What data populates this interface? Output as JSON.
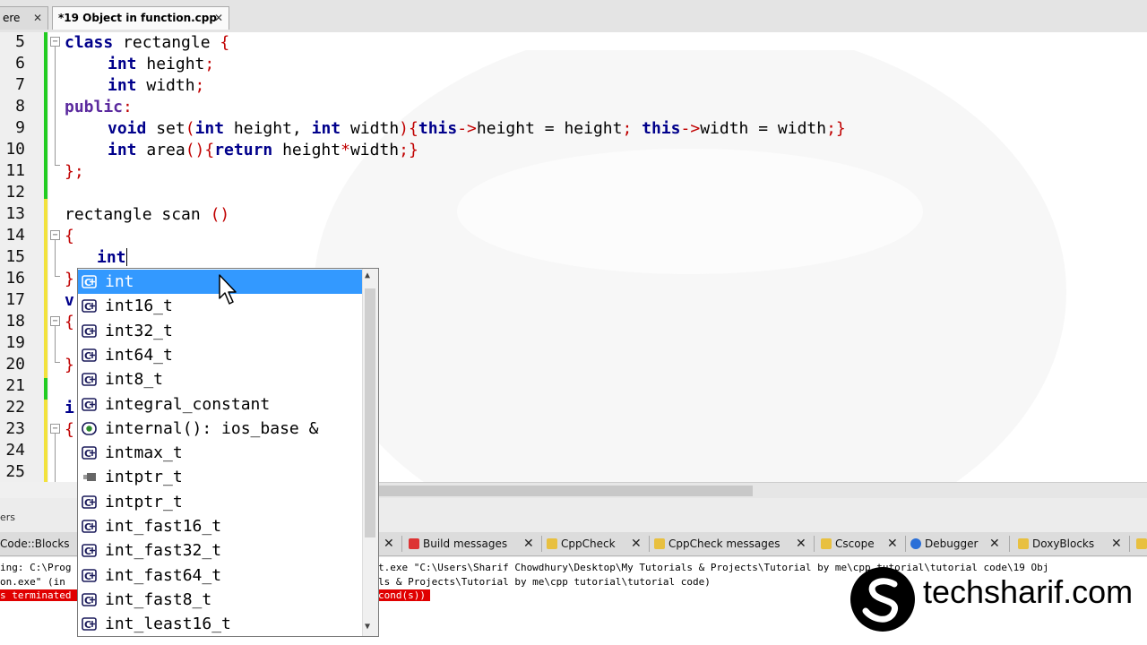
{
  "tabs": [
    {
      "label": "ere",
      "close": "✕"
    },
    {
      "label": "*19 Object in function.cpp",
      "close": "✕"
    }
  ],
  "editor": {
    "line_numbers": [
      "5",
      "6",
      "7",
      "8",
      "9",
      "10",
      "11",
      "12",
      "13",
      "14",
      "15",
      "16",
      "17",
      "18",
      "19",
      "20",
      "21",
      "22",
      "23",
      "24",
      "25"
    ],
    "lines": {
      "l5": {
        "kw": "class",
        "rest": " rectangle ",
        "brace": "{"
      },
      "l6": {
        "kw": "int",
        "rest": " height",
        "semi": ";"
      },
      "l7": {
        "kw": "int",
        "rest": " width",
        "semi": ";"
      },
      "l8": {
        "kw": "public",
        "rest": ":"
      },
      "l9": {
        "kw1": "void",
        "fn": " set",
        "p1": "(",
        "kw2": "int",
        "a": " height, ",
        "kw3": "int",
        "b": " width",
        "p2": "){",
        "kw4": "this",
        "arrow1": "->",
        "c": "height = height",
        "s1": ";",
        "sp": " ",
        "kw5": "this",
        "arrow2": "->",
        "d": "width = width",
        "s2": ";}"
      },
      "l10": {
        "kw1": "int",
        "fn": " area",
        "p": "(){",
        "kw2": "return",
        "rest": " height",
        "star": "*",
        "rest2": "width",
        "end": ";}"
      },
      "l11": {
        "rest": "};"
      },
      "l13": {
        "rest": "rectangle scan ",
        "paren": "()"
      },
      "l14": {
        "rest": "{"
      },
      "l15": {
        "rest": "int"
      },
      "l16": {
        "rest": "}"
      },
      "l17": {
        "rest": "v"
      },
      "l18": {
        "rest": "{"
      },
      "l20": {
        "rest": "}"
      },
      "l22": {
        "rest": "i"
      },
      "l23": {
        "rest": "{"
      }
    }
  },
  "autocomplete": {
    "items": [
      {
        "label": "int",
        "icon": "class-icon",
        "selected": true
      },
      {
        "label": "int16_t",
        "icon": "class-icon"
      },
      {
        "label": "int32_t",
        "icon": "class-icon"
      },
      {
        "label": "int64_t",
        "icon": "class-icon"
      },
      {
        "label": "int8_t",
        "icon": "class-icon"
      },
      {
        "label": "integral_constant",
        "icon": "class-icon"
      },
      {
        "label": "internal(): ios_base &",
        "icon": "function-icon"
      },
      {
        "label": "intmax_t",
        "icon": "class-icon"
      },
      {
        "label": "intptr_t",
        "icon": "typedef-icon"
      },
      {
        "label": "intptr_t",
        "icon": "class-icon"
      },
      {
        "label": "int_fast16_t",
        "icon": "class-icon"
      },
      {
        "label": "int_fast32_t",
        "icon": "class-icon"
      },
      {
        "label": "int_fast64_t",
        "icon": "class-icon"
      },
      {
        "label": "int_fast8_t",
        "icon": "class-icon"
      },
      {
        "label": "int_least16_t",
        "icon": "class-icon"
      }
    ]
  },
  "panel": {
    "header": "ers",
    "tabs": {
      "codeblocks": "Code::Blocks",
      "build_messages": "Build messages",
      "cppcheck": "CppCheck",
      "cppcheck_messages": "CppCheck messages",
      "cscope": "Cscope",
      "debugger": "Debugger",
      "doxyblocks": "DoxyBlocks"
    },
    "log": {
      "l1a": "ing: C:\\Prog",
      "l1b": "t.exe \"C:\\Users\\Sharif Chowdhury\\Desktop\\My Tutorials & Projects\\Tutorial by me\\cpp tutorial\\tutorial code\\19 Obj",
      "l2a": "on.exe\" (in",
      "l2b": "ls & Projects\\Tutorial by me\\cpp tutorial\\tutorial code)",
      "l3a": "s terminated",
      "l3b": "cond(s))"
    }
  },
  "watermark": {
    "text": "techsharif.com"
  },
  "colors": {
    "selection": "#3399ff",
    "keyword": "#00008b",
    "operator": "#c00000",
    "changed_green": "#22cc22",
    "changed_yellow": "#f2e23c"
  }
}
